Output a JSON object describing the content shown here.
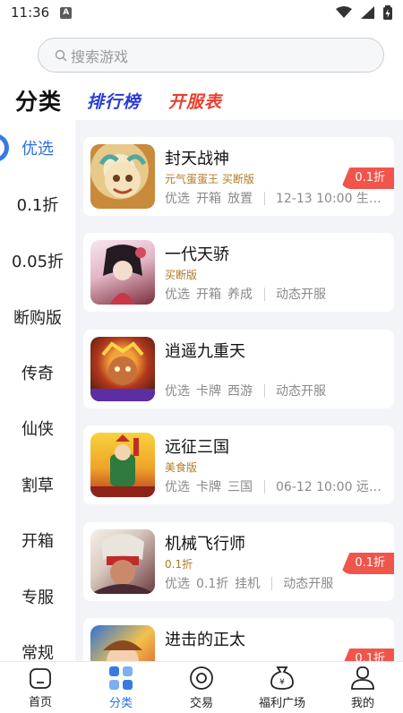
{
  "status": {
    "time": "11:36",
    "notif": "A"
  },
  "search": {
    "placeholder": "搜索游戏"
  },
  "tabs": {
    "main": "分类",
    "rank": "排行榜",
    "open": "开服表"
  },
  "sidebar": {
    "items": [
      {
        "label": "优选",
        "active": true
      },
      {
        "label": "0.1折"
      },
      {
        "label": "0.05折"
      },
      {
        "label": "断购版"
      },
      {
        "label": "传奇"
      },
      {
        "label": "仙侠"
      },
      {
        "label": "割草"
      },
      {
        "label": "开箱"
      },
      {
        "label": "专服"
      },
      {
        "label": "常规"
      }
    ]
  },
  "games": [
    {
      "name": "封天战神",
      "sub": "元气蛋蛋王 买断版",
      "tags": [
        "优选",
        "开箱",
        "放置"
      ],
      "info": "12-13 10:00 生…",
      "badge": "0.1折"
    },
    {
      "name": "一代天骄",
      "sub": "买断版",
      "tags": [
        "优选",
        "开箱",
        "养成"
      ],
      "info": "动态开服",
      "badge": ""
    },
    {
      "name": "逍遥九重天",
      "sub": "",
      "tags": [
        "优选",
        "卡牌",
        "西游"
      ],
      "info": "动态开服",
      "badge": ""
    },
    {
      "name": "远征三国",
      "sub": "美食版",
      "tags": [
        "优选",
        "卡牌",
        "三国"
      ],
      "info": "06-12 10:00 远…",
      "badge": ""
    },
    {
      "name": "机械飞行师",
      "sub": "0.1折",
      "tags": [
        "优选",
        "0.1折",
        "挂机"
      ],
      "info": "动态开服",
      "badge": "0.1折"
    },
    {
      "name": "进击的正太",
      "sub": "",
      "tags": [],
      "info": "",
      "badge": "0.1折"
    }
  ],
  "bottom_nav": [
    {
      "label": "首页",
      "icon": "home-icon"
    },
    {
      "label": "分类",
      "icon": "category-icon",
      "active": true
    },
    {
      "label": "交易",
      "icon": "trade-icon"
    },
    {
      "label": "福利广场",
      "icon": "welfare-icon"
    },
    {
      "label": "我的",
      "icon": "profile-icon"
    }
  ],
  "colors": {
    "accent": "#2d6fde",
    "badge": "#f0554c",
    "rank": "#2a3bd6",
    "open": "#ee3d2d",
    "sub": "#b07a25"
  }
}
